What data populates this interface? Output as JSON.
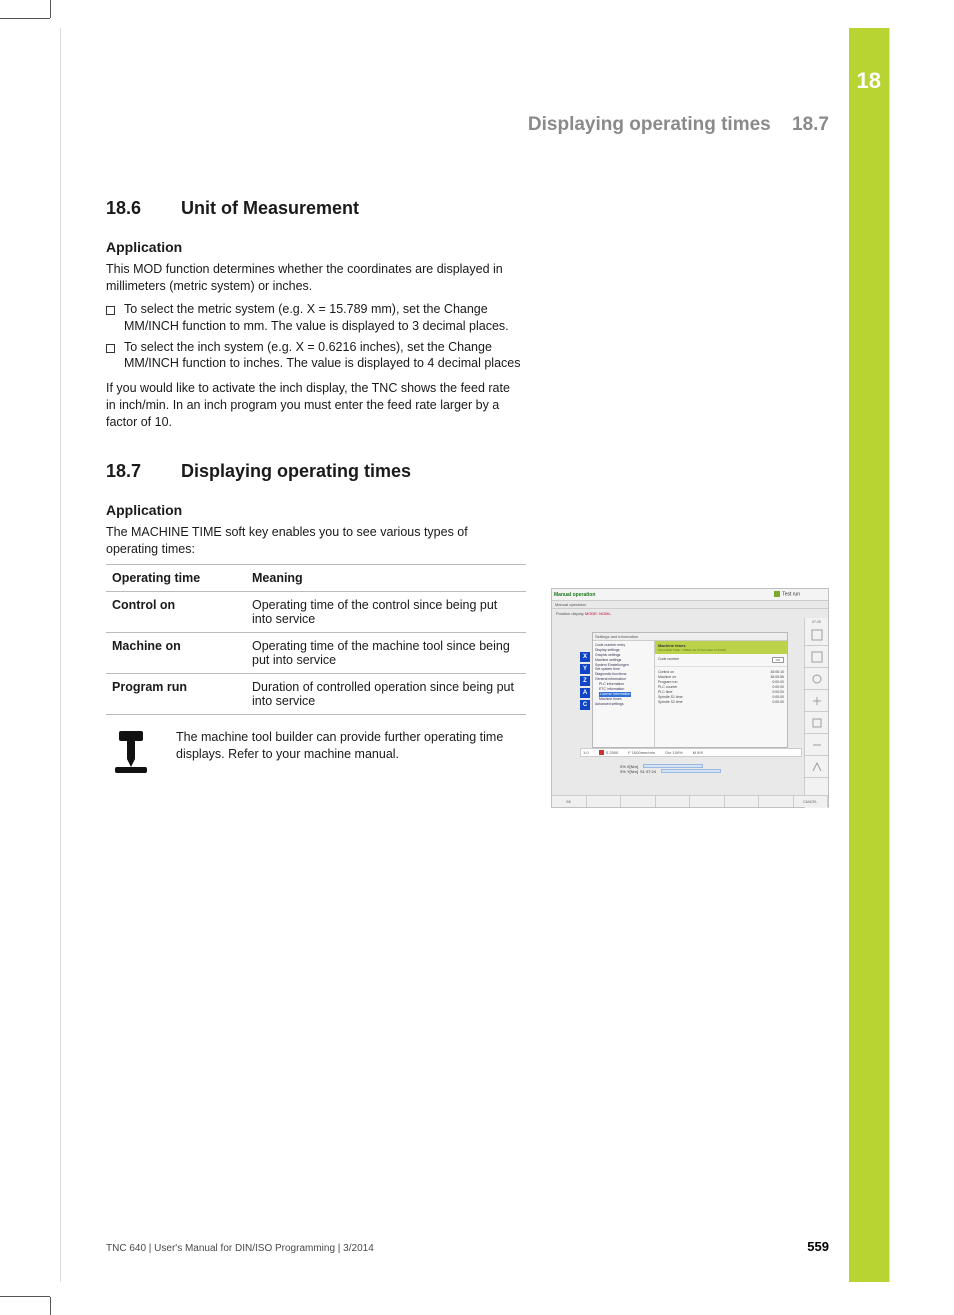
{
  "chapter": {
    "number": "18"
  },
  "runningHead": {
    "title": "Displaying operating times",
    "num": "18.7"
  },
  "sec186": {
    "num": "18.6",
    "title": "Unit of Measurement",
    "sub": "Application",
    "p1": "This MOD function determines whether the coordinates are displayed in millimeters (metric system) or inches.",
    "b1": "To select the metric system (e.g. X = 15.789 mm), set the Change MM/INCH function to mm. The value is displayed to 3 decimal places.",
    "b2": "To select the inch system (e.g. X = 0.6216 inches), set the Change MM/INCH function to inches. The value is displayed to 4 decimal places",
    "p2": "If you would like to activate the inch display, the TNC shows the feed rate in inch/min. In an inch program you must enter the feed rate larger by a factor of 10."
  },
  "sec187": {
    "num": "18.7",
    "title": "Displaying operating times",
    "sub": "Application",
    "p1": "The MACHINE TIME soft key enables you to see various types of operating times:",
    "table": {
      "h1": "Operating time",
      "h2": "Meaning",
      "rows": [
        {
          "k": "Control on",
          "v": "Operating time of the control since being put into service"
        },
        {
          "k": "Machine on",
          "v": "Operating time of the machine tool since being put into service"
        },
        {
          "k": "Program run",
          "v": "Duration of controlled operation since being put into service"
        }
      ]
    },
    "note": "The machine tool builder can provide further operating time displays. Refer to your machine manual."
  },
  "screenshot": {
    "title_left": "Manual operation",
    "title_sub": "Manual operation",
    "title_right": "Test run",
    "clock": "07:25",
    "posline_prefix": "Position display",
    "posline_mode": "MODE: NOML.",
    "axes": [
      "X",
      "Y",
      "Z",
      "A",
      "C"
    ],
    "dialog_title": "Settings and information",
    "nav": {
      "n1": "Code-number entry",
      "n2": "Display settings",
      "n3": "Graphic settings",
      "n4": "Machine settings",
      "n5": "System Einstellungen",
      "n6": "Set system time",
      "n7": "Diagnostic functions",
      "n8": "General information",
      "n9": "PLC information",
      "n10": "ETC information",
      "n11_hl": "License information",
      "n12": "Machine times",
      "n13": "Advanced settings"
    },
    "panel": {
      "head": "Machine times",
      "head_sub": "MACHINE TIME / TIMES OF ATTACHED SYSTEM",
      "key_label": "Code number",
      "ok": "OK",
      "rows": [
        {
          "k": "Control on",
          "v": "36:06:10"
        },
        {
          "k": "Machine on",
          "v": "36:05:56"
        },
        {
          "k": "Program run",
          "v": "0:00:00"
        },
        {
          "k": "PLC counter",
          "v": "0:00:00"
        },
        {
          "k": "PLC time",
          "v": "0:00:00"
        },
        {
          "k": "Spindle S1 time",
          "v": "0:00:00"
        },
        {
          "k": "Spindle S2 time",
          "v": "0:00:00"
        }
      ]
    },
    "status": {
      "s": "S 2500",
      "f": "F 1000mm/min",
      "ovr": "Ovr 100%",
      "m": "M 5/9"
    },
    "status_left": "1:0",
    "feed1_l": "0% X[Nm]",
    "feed2_l": "0% Y[Nm]",
    "feed2_r": "S1 07:24",
    "softkeys": {
      "sk1": "BK",
      "sk8": "CANCEL"
    }
  },
  "footer": {
    "left": "TNC 640 | User's Manual for DIN/ISO Programming | 3/2014",
    "page": "559"
  }
}
